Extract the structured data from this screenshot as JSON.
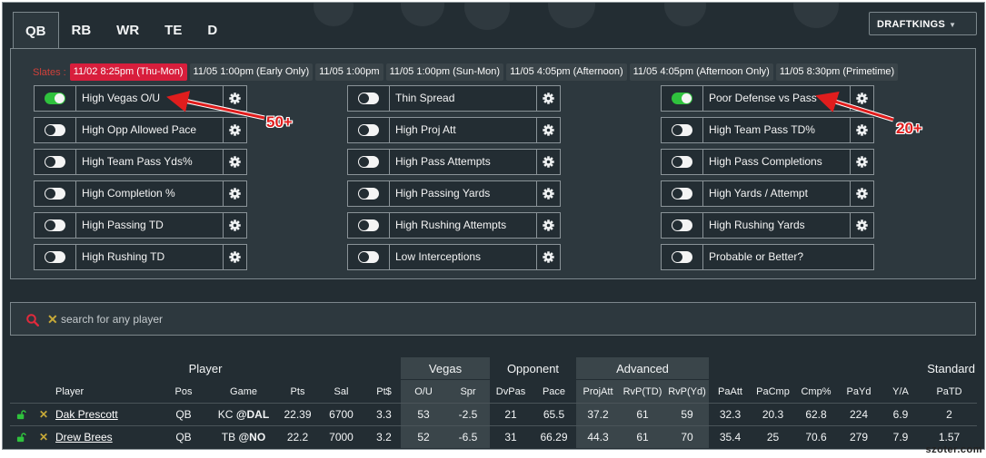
{
  "position_tabs": [
    {
      "label": "QB",
      "active": true
    },
    {
      "label": "RB",
      "active": false
    },
    {
      "label": "WR",
      "active": false
    },
    {
      "label": "TE",
      "active": false
    },
    {
      "label": "D",
      "active": false
    }
  ],
  "site_select": {
    "value": "DRAFTKINGS"
  },
  "slates": {
    "label": "Slates :",
    "items": [
      {
        "label": "11/02 8:25pm (Thu-Mon)",
        "active": true
      },
      {
        "label": "11/05 1:00pm (Early Only)",
        "active": false
      },
      {
        "label": "11/05 1:00pm",
        "active": false
      },
      {
        "label": "11/05 1:00pm (Sun-Mon)",
        "active": false
      },
      {
        "label": "11/05 4:05pm (Afternoon)",
        "active": false
      },
      {
        "label": "11/05 4:05pm (Afternoon Only)",
        "active": false
      },
      {
        "label": "11/05 8:30pm (Primetime)",
        "active": false
      }
    ]
  },
  "filters": {
    "col1": [
      {
        "label": "High Vegas O/U",
        "on": true,
        "settings": true
      },
      {
        "label": "High Opp Allowed Pace",
        "on": false,
        "settings": true
      },
      {
        "label": "High Team Pass Yds%",
        "on": false,
        "settings": true
      },
      {
        "label": "High Completion %",
        "on": false,
        "settings": true
      },
      {
        "label": "High Passing TD",
        "on": false,
        "settings": true
      },
      {
        "label": "High Rushing TD",
        "on": false,
        "settings": true
      }
    ],
    "col2": [
      {
        "label": "Thin Spread",
        "on": false,
        "settings": true
      },
      {
        "label": "High Proj Att",
        "on": false,
        "settings": true
      },
      {
        "label": "High Pass Attempts",
        "on": false,
        "settings": true
      },
      {
        "label": "High Passing Yards",
        "on": false,
        "settings": true
      },
      {
        "label": "High Rushing Attempts",
        "on": false,
        "settings": true
      },
      {
        "label": "Low Interceptions",
        "on": false,
        "settings": true
      }
    ],
    "col3": [
      {
        "label": "Poor Defense vs Pass",
        "on": true,
        "settings": true
      },
      {
        "label": "High Team Pass TD%",
        "on": false,
        "settings": true
      },
      {
        "label": "High Pass Completions",
        "on": false,
        "settings": true
      },
      {
        "label": "High Yards / Attempt",
        "on": false,
        "settings": true
      },
      {
        "label": "High Rushing Yards",
        "on": false,
        "settings": true
      },
      {
        "label": "Probable or Better?",
        "on": false,
        "settings": false
      }
    ]
  },
  "annotations": {
    "a1": "50+",
    "a2": "20+"
  },
  "search": {
    "placeholder": "search for any player"
  },
  "table": {
    "groups": {
      "player": "Player",
      "vegas": "Vegas",
      "opponent": "Opponent",
      "advanced": "Advanced",
      "standard": "Standard"
    },
    "columns": [
      "Player",
      "Pos",
      "Game",
      "Pts",
      "Sal",
      "Pt$",
      "O/U",
      "Spr",
      "DvPas",
      "Pace",
      "ProjAtt",
      "RvP(TD)",
      "RvP(Yd)",
      "PaAtt",
      "PaCmp",
      "Cmp%",
      "PaYd",
      "Y/A",
      "PaTD"
    ],
    "rows": [
      {
        "name": "Dak Prescott",
        "pos": "QB",
        "team": "KC",
        "opp": "@DAL",
        "pts": "22.39",
        "sal": "6700",
        "pt": "3.3",
        "ou": "53",
        "spr": "-2.5",
        "dvpas": "21",
        "pace": "65.5",
        "projatt": "37.2",
        "rvptd": "61",
        "rvpyd": "59",
        "paatt": "32.3",
        "pacmp": "20.3",
        "cmp": "62.8",
        "payd": "224",
        "ya": "6.9",
        "patd": "2"
      },
      {
        "name": "Drew Brees",
        "pos": "QB",
        "team": "TB",
        "opp": "@NO",
        "pts": "22.2",
        "sal": "7000",
        "pt": "3.2",
        "ou": "52",
        "spr": "-6.5",
        "dvpas": "31",
        "pace": "66.29",
        "projatt": "44.3",
        "rvptd": "61",
        "rvpyd": "70",
        "paatt": "35.4",
        "pacmp": "25",
        "cmp": "70.6",
        "payd": "279",
        "ya": "7.9",
        "patd": "1.57"
      }
    ]
  },
  "watermark": "szoter.com",
  "colors": {
    "accent_red": "#d81e3c",
    "toggle_on": "#2fc23d",
    "bg": "#232d33",
    "panel": "#2d383e"
  }
}
